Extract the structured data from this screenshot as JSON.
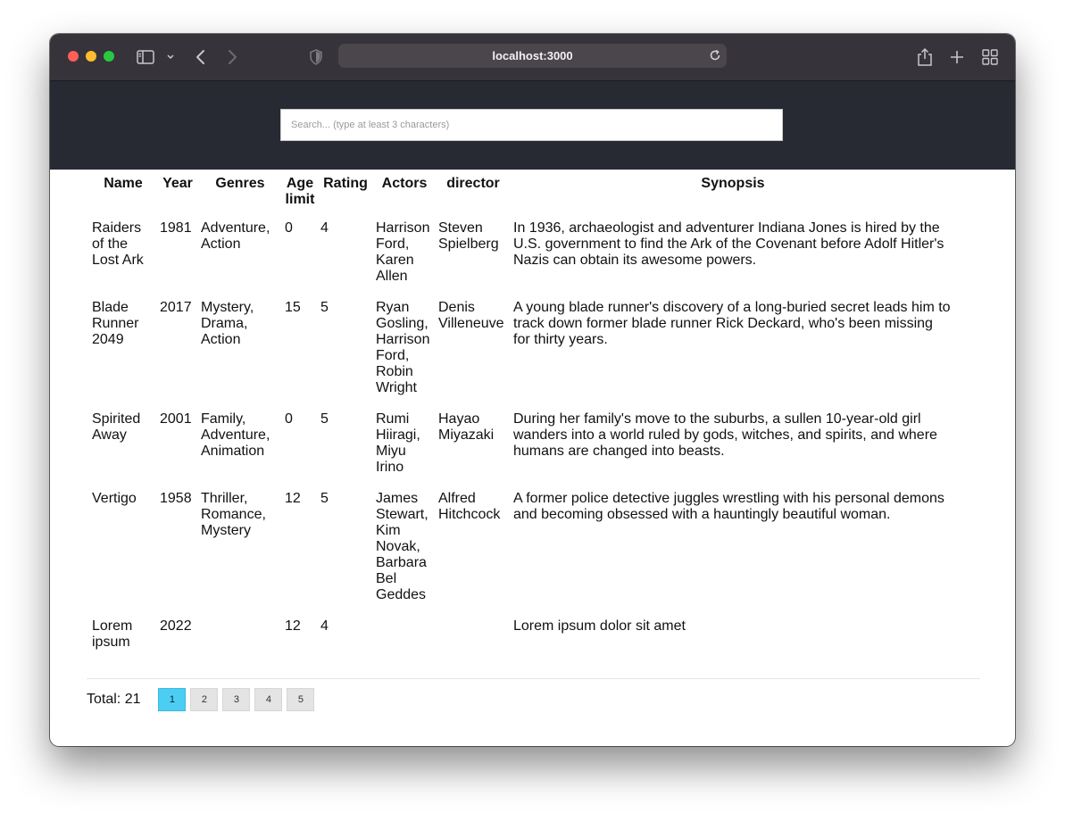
{
  "browser": {
    "url": "localhost:3000"
  },
  "search": {
    "placeholder": "Search... (type at least 3 characters)",
    "value": ""
  },
  "table": {
    "headers": [
      "Name",
      "Year",
      "Genres",
      "Age limit",
      "Rating",
      "Actors",
      "director",
      "Synopsis"
    ],
    "rows": [
      {
        "name": "Raiders of the Lost Ark",
        "year": "1981",
        "genres": "Adventure, Action",
        "age_limit": "0",
        "rating": "4",
        "actors": "Harrison Ford, Karen Allen",
        "director": "Steven Spielberg",
        "synopsis": "In 1936, archaeologist and adventurer Indiana Jones is hired by the U.S. government to find the Ark of the Covenant before Adolf Hitler's Nazis can obtain its awesome powers."
      },
      {
        "name": "Blade Runner 2049",
        "year": "2017",
        "genres": "Mystery, Drama, Action",
        "age_limit": "15",
        "rating": "5",
        "actors": "Ryan Gosling, Harrison Ford, Robin Wright",
        "director": "Denis Villeneuve",
        "synopsis": "A young blade runner's discovery of a long-buried secret leads him to track down former blade runner Rick Deckard, who's been missing for thirty years."
      },
      {
        "name": "Spirited Away",
        "year": "2001",
        "genres": "Family, Adventure, Animation",
        "age_limit": "0",
        "rating": "5",
        "actors": "Rumi Hiiragi, Miyu Irino",
        "director": "Hayao Miyazaki",
        "synopsis": "During her family's move to the suburbs, a sullen 10-year-old girl wanders into a world ruled by gods, witches, and spirits, and where humans are changed into beasts."
      },
      {
        "name": "Vertigo",
        "year": "1958",
        "genres": "Thriller, Romance, Mystery",
        "age_limit": "12",
        "rating": "5",
        "actors": "James Stewart, Kim Novak, Barbara Bel Geddes",
        "director": "Alfred Hitchcock",
        "synopsis": "A former police detective juggles wrestling with his personal demons and becoming obsessed with a hauntingly beautiful woman."
      },
      {
        "name": "Lorem ipsum",
        "year": "2022",
        "genres": "",
        "age_limit": "12",
        "rating": "4",
        "actors": "",
        "director": "",
        "synopsis": "Lorem ipsum dolor sit amet"
      }
    ]
  },
  "pagination": {
    "total_label": "Total: 21",
    "pages": [
      "1",
      "2",
      "3",
      "4",
      "5"
    ],
    "current_page": "1"
  },
  "colors": {
    "banner": "#272a33",
    "active_page": "#4ccdf4",
    "titlebar": "#37333a"
  },
  "icons": [
    "sidebar-icon",
    "chevron-down-icon",
    "back-icon",
    "forward-icon",
    "shield-icon",
    "reload-icon",
    "share-icon",
    "new-tab-icon",
    "tab-overview-icon"
  ]
}
